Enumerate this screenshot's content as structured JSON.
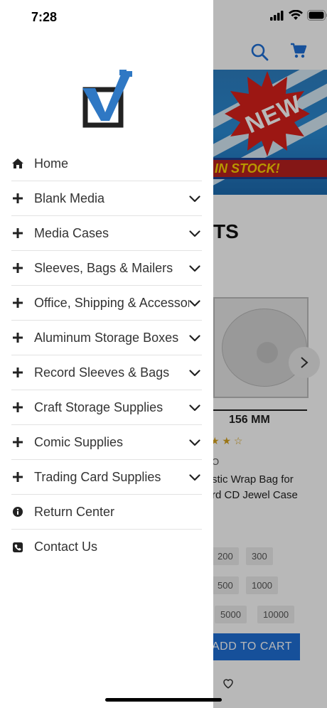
{
  "status_bar": {
    "time": "7:28"
  },
  "background": {
    "banner_top_text": "NEW",
    "banner_bottom_text": "IN STOCK!",
    "heading_fragment": "TS",
    "dimension_label": "156 MM",
    "rating_fragment": "★ ★ ☆",
    "small_fragment": "O",
    "product_title_fragment": "stic Wrap Bag for\nrd CD Jewel Case",
    "quantities": [
      "200",
      "300",
      "500",
      "1000",
      "5000",
      "10000"
    ],
    "add_to_cart_fragment": "ADD TO CART"
  },
  "drawer": {
    "menu": [
      {
        "label": "Home",
        "icon": "home-icon",
        "has_chevron": false
      },
      {
        "label": "Blank Media",
        "icon": "plus-icon",
        "has_chevron": true
      },
      {
        "label": "Media Cases",
        "icon": "plus-icon",
        "has_chevron": true
      },
      {
        "label": "Sleeves, Bags & Mailers",
        "icon": "plus-icon",
        "has_chevron": true
      },
      {
        "label": "Office, Shipping & Accessories",
        "icon": "plus-icon",
        "has_chevron": true
      },
      {
        "label": "Aluminum Storage Boxes",
        "icon": "plus-icon",
        "has_chevron": true
      },
      {
        "label": "Record Sleeves & Bags",
        "icon": "plus-icon",
        "has_chevron": true
      },
      {
        "label": "Craft Storage Supplies",
        "icon": "plus-icon",
        "has_chevron": true
      },
      {
        "label": "Comic Supplies",
        "icon": "plus-icon",
        "has_chevron": true
      },
      {
        "label": "Trading Card Supplies",
        "icon": "plus-icon",
        "has_chevron": true
      },
      {
        "label": "Return Center",
        "icon": "info-icon",
        "has_chevron": false
      },
      {
        "label": "Contact Us",
        "icon": "phone-icon",
        "has_chevron": false
      }
    ]
  },
  "colors": {
    "brand_blue": "#2f78c4",
    "accent_blue": "#1f6fd6",
    "text_dark": "#333333",
    "divider": "#e2e2e2"
  }
}
